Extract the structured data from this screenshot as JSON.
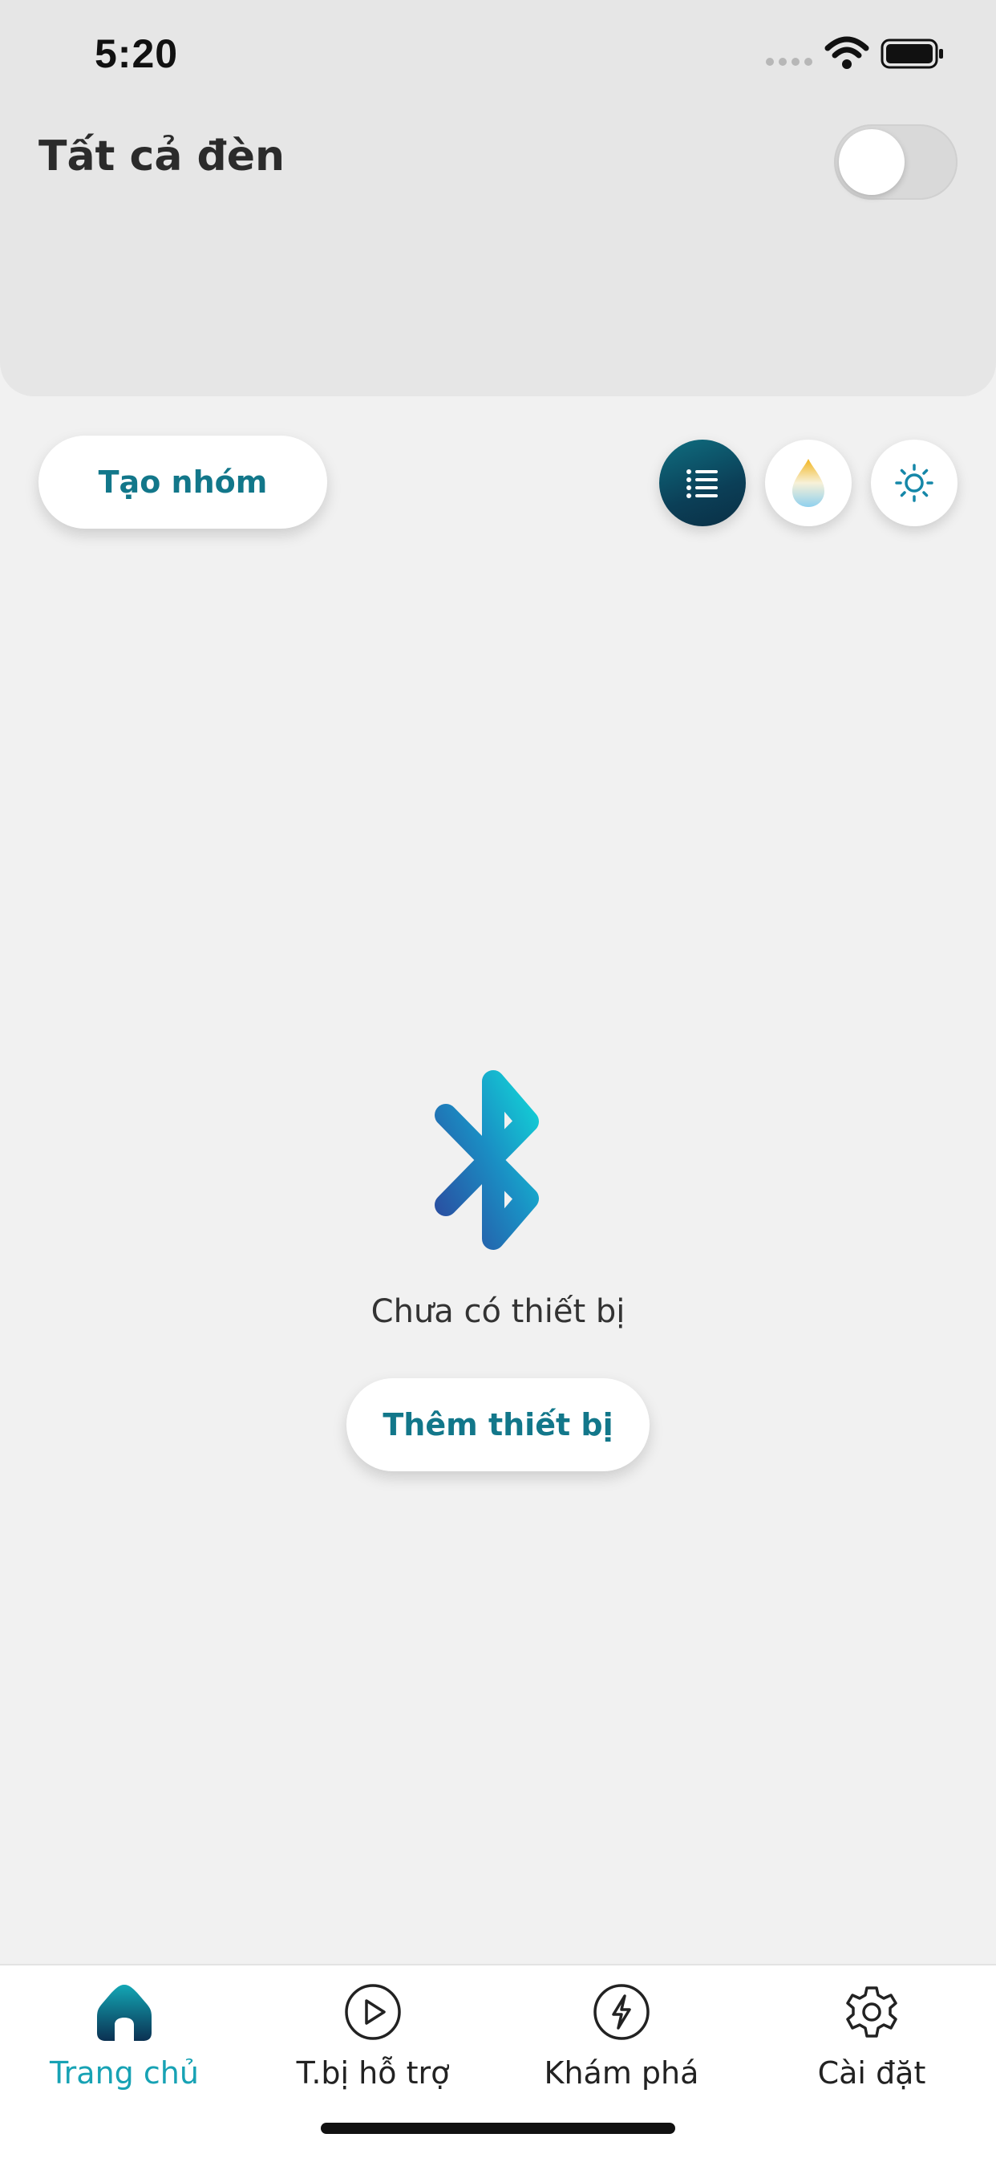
{
  "status_bar": {
    "time": "5:20"
  },
  "header": {
    "title": "Tất cả đèn",
    "all_lights_on": false
  },
  "actions": {
    "create_group_label": "Tạo nhóm",
    "view_buttons": [
      {
        "icon": "list-icon",
        "active": true
      },
      {
        "icon": "color-temperature-drop-icon",
        "active": false
      },
      {
        "icon": "brightness-sun-icon",
        "active": false
      }
    ]
  },
  "empty_state": {
    "icon": "bluetooth-icon",
    "message": "Chưa có thiết bị",
    "add_device_label": "Thêm thiết bị"
  },
  "tabbar": {
    "items": [
      {
        "label": "Trang chủ",
        "icon": "home-icon",
        "active": true
      },
      {
        "label": "T.bị hỗ trợ",
        "icon": "play-circle-icon",
        "active": false
      },
      {
        "label": "Khám phá",
        "icon": "lightning-circle-icon",
        "active": false
      },
      {
        "label": "Cài đặt",
        "icon": "gear-icon",
        "active": false
      }
    ]
  },
  "colors": {
    "accent": "#12778a",
    "active_tab": "#17a2b4",
    "header_bg": "#e6e6e6",
    "page_bg": "#f1f1f1"
  }
}
